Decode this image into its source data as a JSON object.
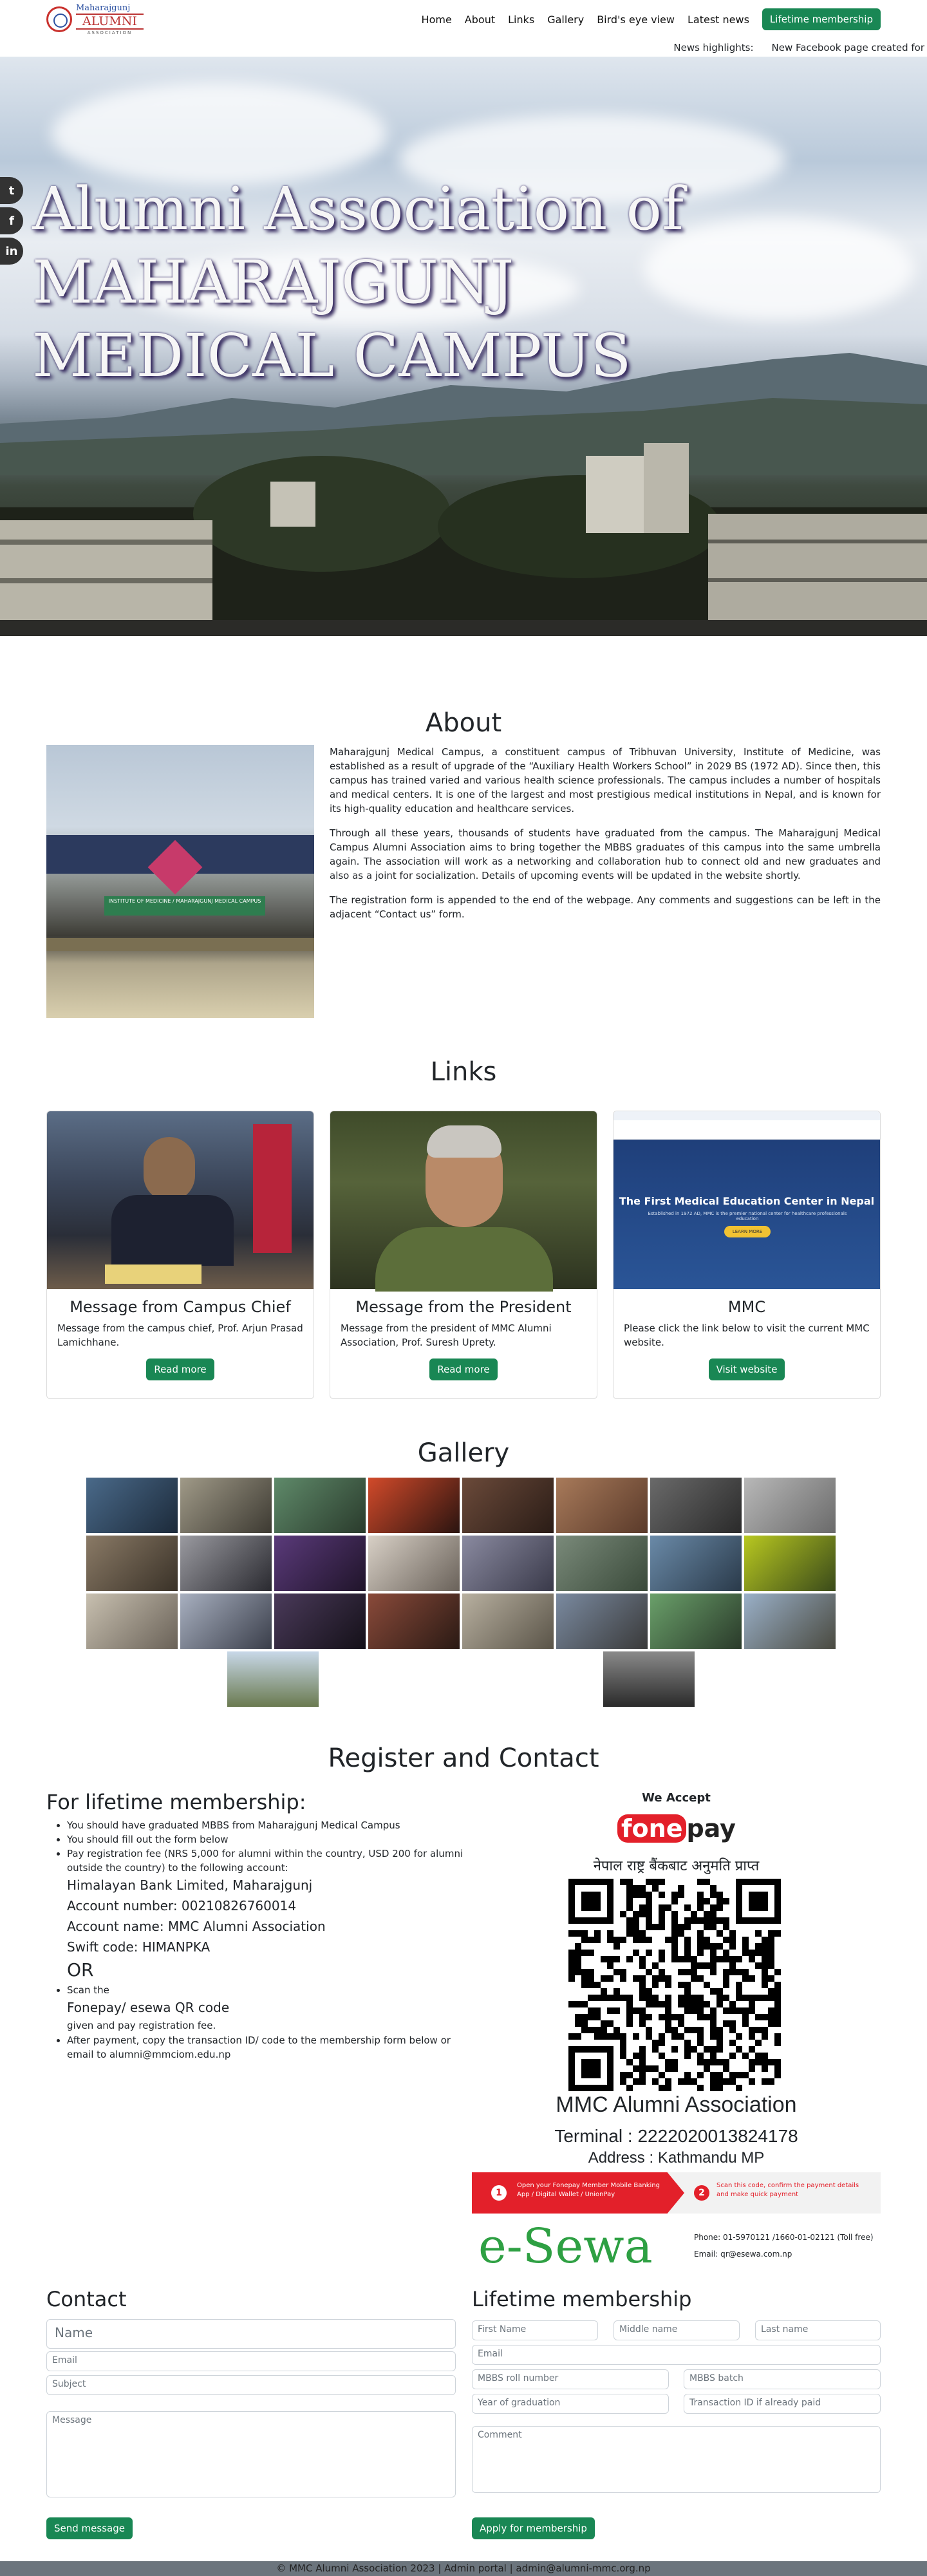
{
  "nav": {
    "logo_line1": "Maharajgunj",
    "logo_line2": "ALUMNI",
    "logo_line3": "ASSOCIATION",
    "items": [
      "Home",
      "About",
      "Links",
      "Gallery",
      "Bird's eye view",
      "Latest news"
    ],
    "cta": "Lifetime membership"
  },
  "ticker": {
    "label": "News highlights:",
    "text": "New Facebook page created for"
  },
  "hero": {
    "title": "Alumni Association of MAHARAJGUNJ MEDICAL CAMPUS"
  },
  "social": [
    "t",
    "f",
    "in"
  ],
  "about": {
    "heading": "About",
    "p1": "Maharajgunj Medical Campus, a constituent campus of Tribhuvan University, Institute of Medicine, was established as a result of upgrade of the “Auxiliary Health Workers School” in 2029 BS (1972 AD). Since then, this campus has trained varied and various health science professionals. The campus includes a number of hospitals and medical centers. It is one of the largest and most prestigious medical institutions in Nepal, and is known for its high-quality education and healthcare services.",
    "p2": "Through all these years, thousands of students have graduated from the campus. The Maharajgunj Medical Campus Alumni Association aims to bring together the MBBS graduates of this campus into the same umbrella again. The association will work as a networking and collaboration hub to connect old and new graduates and also as a joint for socialization. Details of upcoming events will be updated in the website shortly.",
    "p3": "The registration form is appended to the end of the webpage. Any comments and suggestions can be left in the adjacent “Contact us” form.",
    "sign": "INSTITUTE OF MEDICINE / MAHARAJGUNJ MEDICAL CAMPUS"
  },
  "links": {
    "heading": "Links",
    "cards": [
      {
        "title": "Message from Campus Chief",
        "text": "Message from the campus chief, Prof. Arjun Prasad Lamichhane.",
        "button": "Read more"
      },
      {
        "title": "Message from the President",
        "text": "Message from the president of MMC Alumni Association, Prof. Suresh Uprety.",
        "button": "Read more"
      },
      {
        "title": "MMC",
        "text": "Please click the link below to visit the current MMC website.",
        "button": "Visit website",
        "screenshot_title": "The First Medical Education Center in Nepal",
        "screenshot_sub": "Established in 1972 AD, MMC is the premier national center for healthcare professionals education",
        "screenshot_btn": "LEARN MORE"
      }
    ]
  },
  "gallery": {
    "heading": "Gallery"
  },
  "register": {
    "heading": "Register and Contact",
    "sub": "For lifetime membership:",
    "b1": "You should have graduated MBBS from Maharajgunj Medical Campus",
    "b2": "You should fill out the form below",
    "b3": "Pay registration fee (NRS 5,000 for alumni within the country, USD 200 for alumni outside the country) to the following account:",
    "bank": "Himalayan Bank Limited, Maharajgunj",
    "acc_no": "Account number: 00210826760014",
    "acc_name": "Account name: MMC Alumni Association",
    "swift": "Swift code: HIMANPKA",
    "or": "OR",
    "b4": "Scan the",
    "qr_label": "Fonepay/ esewa QR code",
    "b4_tail": "given and pay registration fee.",
    "b5": "After payment, copy the transaction ID/ code to the membership form below or email to alumni@mmciom.edu.np"
  },
  "qr": {
    "accept": "We Accept",
    "fonepay_a": "fone",
    "fonepay_b": "pay",
    "nepali": "नेपाल राष्ट्र बैंकबाट अनुमति प्राप्त",
    "name": "MMC Alumni Association",
    "terminal": "Terminal : 2222020013824178",
    "address": "Address : Kathmandu MP",
    "step1": "Open your Fonepay Member Mobile Banking App / Digital Wallet / UnionPay",
    "step2": "Scan this code, confirm the payment details and make quick payment",
    "esewa": "e-Sewa",
    "phone": "Phone:  01-5970121 /1660-01-02121 (Toll free)",
    "email": "Email:  qr@esewa.com.np"
  },
  "contact": {
    "heading": "Contact",
    "name_ph": "Name",
    "email_ph": "Email",
    "subject_ph": "Subject",
    "message_ph": "Message",
    "button": "Send message"
  },
  "membership": {
    "heading": "Lifetime membership",
    "first": "First Name",
    "middle": "Middle name",
    "last": "Last name",
    "email": "Email",
    "roll": "MBBS roll number",
    "batch": "MBBS batch",
    "year": "Year of graduation",
    "txn": "Transaction ID if already paid",
    "comment": "Comment",
    "button": "Apply for membership"
  },
  "footer": {
    "text": "© MMC Alumni Association 2023 | Admin portal | admin@alumni-mmc.org.np"
  }
}
